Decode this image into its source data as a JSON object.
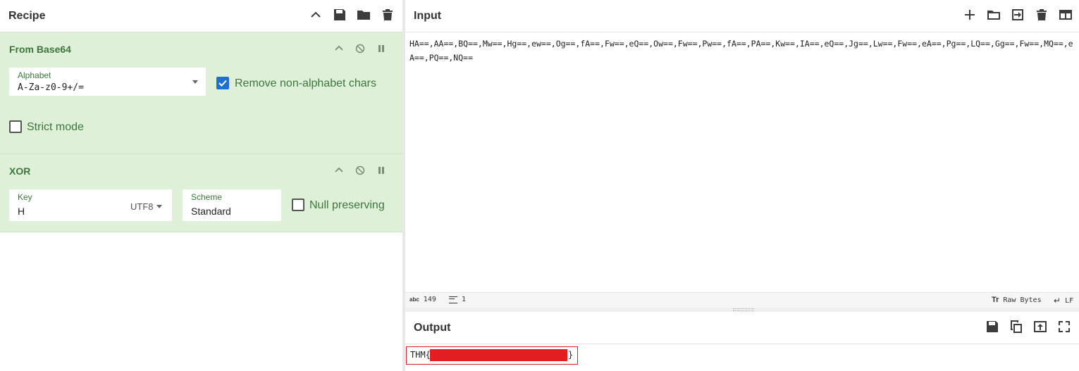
{
  "recipe": {
    "title": "Recipe",
    "header_icons": [
      "chevron-up-icon",
      "save-icon",
      "folder-icon",
      "trash-icon"
    ],
    "operations": [
      {
        "title": "From Base64",
        "alphabet": {
          "label": "Alphabet",
          "value": "A-Za-z0-9+/="
        },
        "remove_non_alphabet": {
          "label": "Remove non-alphabet chars",
          "checked": true
        },
        "strict_mode": {
          "label": "Strict mode",
          "checked": false
        }
      },
      {
        "title": "XOR",
        "key": {
          "label": "Key",
          "value": "H",
          "encoding": "UTF8"
        },
        "scheme": {
          "label": "Scheme",
          "value": "Standard"
        },
        "null_preserving": {
          "label": "Null preserving",
          "checked": false
        }
      }
    ]
  },
  "input": {
    "title": "Input",
    "header_icons": [
      "plus-icon",
      "folder-icon",
      "import-icon",
      "trash-icon",
      "layout-icon"
    ],
    "text": "HA==,AA==,BQ==,Mw==,Hg==,ew==,Og==,fA==,Fw==,eQ==,Ow==,Fw==,Pw==,fA==,PA==,Kw==,IA==,eQ==,Jg==,Lw==,Fw==,eA==,Pg==,LQ==,Gg==,Fw==,MQ==,eA==,PQ==,NQ==",
    "status": {
      "length_label": "abc",
      "length": "149",
      "lines": "1",
      "mode_label": "Tr",
      "mode": "Raw Bytes",
      "eol": "LF"
    }
  },
  "output": {
    "title": "Output",
    "header_icons": [
      "save-icon",
      "copy-icon",
      "replace-input-icon",
      "maximize-icon"
    ],
    "prefix": "THM{",
    "suffix": "}"
  },
  "colors": {
    "op_background": "#dff0d8",
    "op_text": "#3c763d",
    "checkbox_on": "#1f6fd1",
    "redaction": "#e31e1e"
  }
}
